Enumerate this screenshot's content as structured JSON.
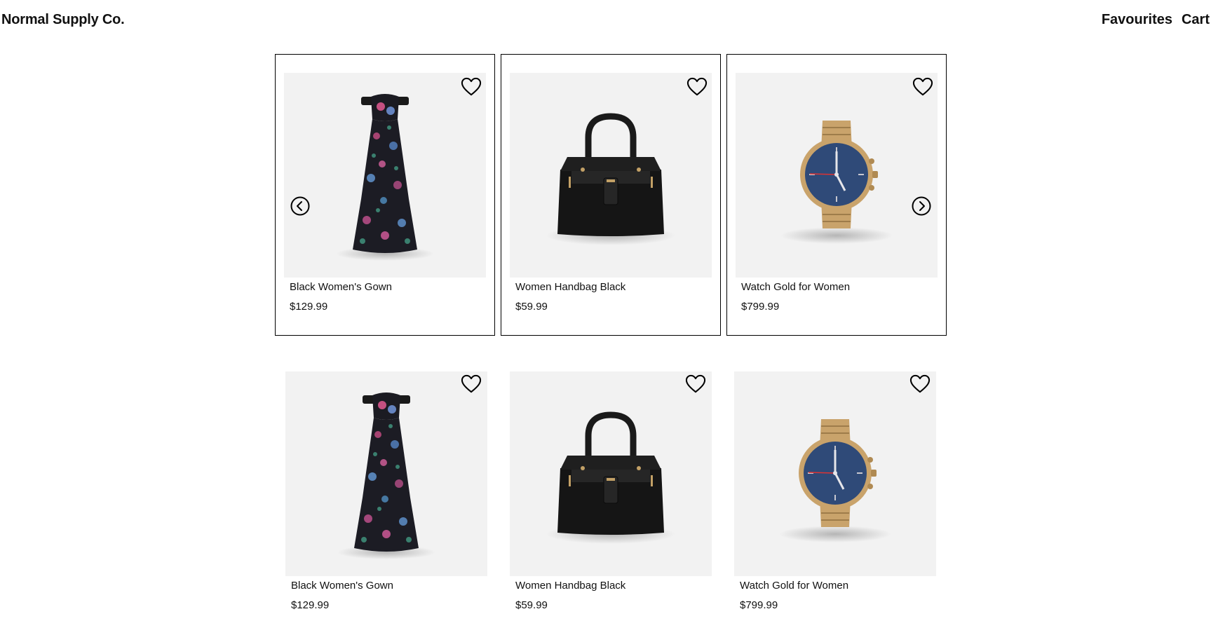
{
  "header": {
    "brand": "Normal Supply Co.",
    "nav": [
      "Favourites",
      "Cart"
    ]
  },
  "carousel": {
    "prev_icon": "chevron-left-circle-icon",
    "next_icon": "chevron-right-circle-icon",
    "products": [
      {
        "name": "Black Women's Gown",
        "price": "$129.99",
        "image": "gown"
      },
      {
        "name": "Women Handbag Black",
        "price": "$59.99",
        "image": "handbag"
      },
      {
        "name": "Watch Gold for Women",
        "price": "$799.99",
        "image": "watch"
      }
    ]
  },
  "grid": {
    "products": [
      {
        "name": "Black Women's Gown",
        "price": "$129.99",
        "image": "gown"
      },
      {
        "name": "Women Handbag Black",
        "price": "$59.99",
        "image": "handbag"
      },
      {
        "name": "Watch Gold for Women",
        "price": "$799.99",
        "image": "watch"
      }
    ]
  },
  "icons": {
    "favourite": "heart-outline-icon"
  },
  "colors": {
    "image_bg": "#f2f2f2",
    "border": "#000000",
    "watch_gold": "#c9a36b",
    "watch_dial": "#2f4a78"
  }
}
